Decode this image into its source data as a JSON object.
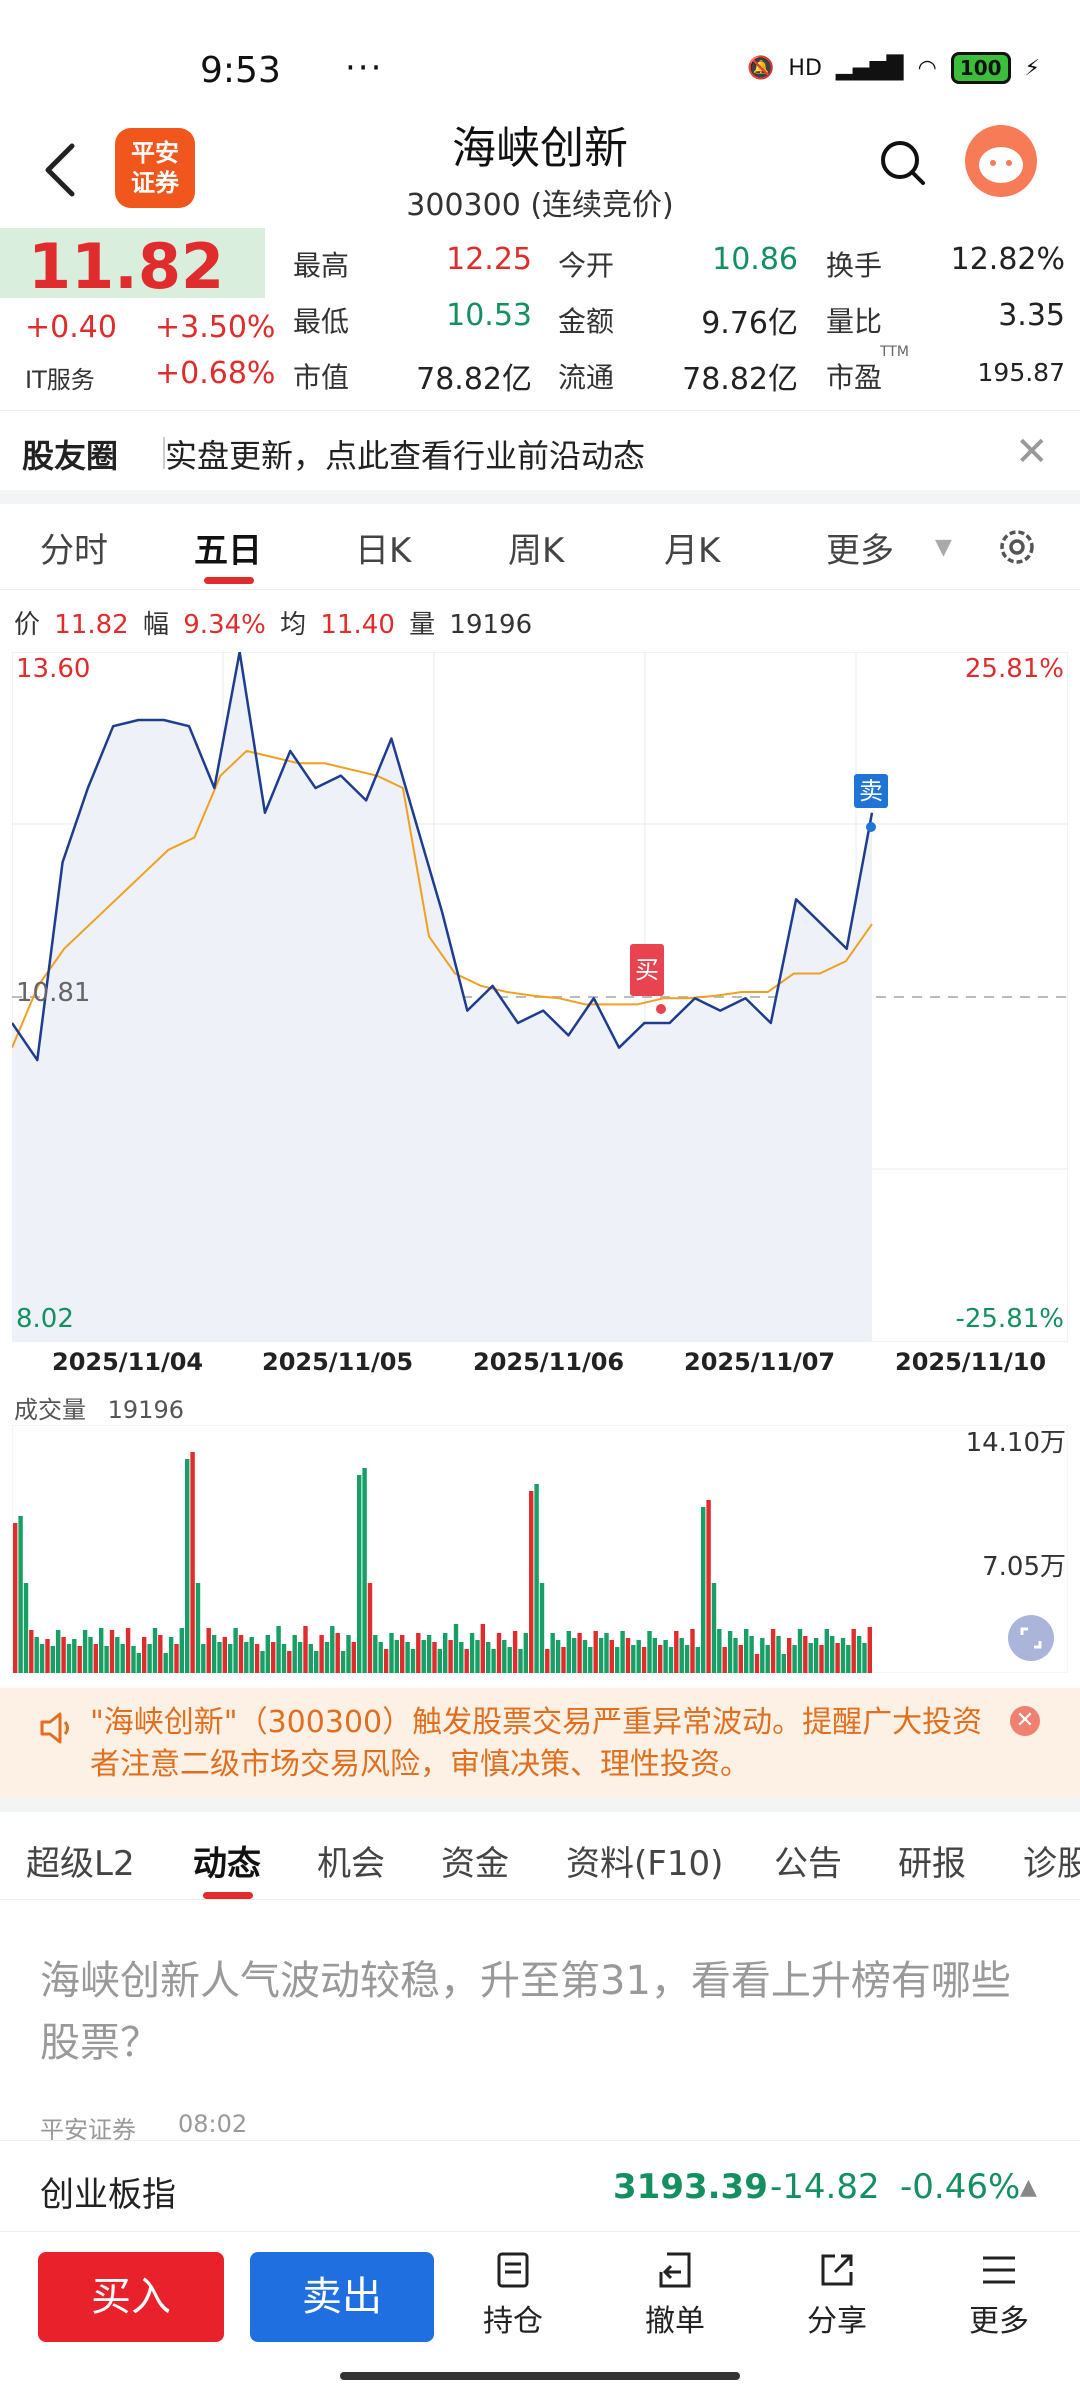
{
  "status_bar": {
    "time": "9:53",
    "dots": "···",
    "network": "HD",
    "battery": "100"
  },
  "header": {
    "stock_name": "海峡创新",
    "stock_code": "300300 (连续竞价)",
    "broker_logo": "平安\n证券"
  },
  "quote": {
    "price": "11.82",
    "change_abs": "+0.40",
    "change_pct": "+3.50%",
    "sector_name": "IT服务",
    "sector_pct": "+0.68%",
    "rows": [
      [
        {
          "label": "最高",
          "value": "12.25",
          "color": "red"
        },
        {
          "label": "今开",
          "value": "10.86",
          "color": "green"
        },
        {
          "label": "换手",
          "value": "12.82%",
          "color": "black"
        }
      ],
      [
        {
          "label": "最低",
          "value": "10.53",
          "color": "green"
        },
        {
          "label": "金额",
          "value": "9.76亿",
          "color": "black"
        },
        {
          "label": "量比",
          "value": "3.35",
          "color": "black"
        }
      ],
      [
        {
          "label": "市值",
          "value": "78.82亿",
          "color": "black"
        },
        {
          "label": "流通",
          "value": "78.82亿",
          "color": "black"
        },
        {
          "label": "市盈",
          "value": "195.87",
          "color": "black",
          "sup": "TTM"
        }
      ]
    ]
  },
  "banner": {
    "title": "股友圈",
    "text": "实盘更新，点此查看行业前沿动态"
  },
  "chart_tabs": {
    "items": [
      "分时",
      "五日",
      "日K",
      "周K",
      "月K",
      "更多"
    ],
    "active": "五日"
  },
  "price_info": {
    "price_label": "价",
    "price": "11.82",
    "amp_label": "幅",
    "amp": "9.34%",
    "avg_label": "均",
    "avg": "11.40",
    "vol_label": "量",
    "vol": "19196"
  },
  "chart_labels": {
    "y_top": "13.60",
    "y_mid": "10.81",
    "y_bottom": "8.02",
    "pct_top": "25.81%",
    "pct_bottom": "-25.81%",
    "buy_marker": "买",
    "sell_marker": "卖"
  },
  "chart_data": {
    "type": "line",
    "x": [
      "2025/11/04",
      "2025/11/05",
      "2025/11/06",
      "2025/11/07",
      "2025/11/10"
    ],
    "ylim": [
      8.02,
      13.6
    ],
    "reference_price": 10.81,
    "series": [
      {
        "points": [
          10.6,
          10.3,
          11.9,
          12.5,
          13.0,
          13.05,
          13.05,
          13.0,
          12.5,
          13.6,
          12.3,
          12.8,
          12.5,
          12.6,
          12.4,
          12.9,
          12.2,
          11.5,
          10.7,
          10.9,
          10.6,
          10.7,
          10.5,
          10.8,
          10.4,
          10.6,
          10.6,
          10.8,
          10.7,
          10.8,
          10.6,
          11.6,
          11.4,
          11.2,
          12.3
        ],
        "stroke": "#1e3d8f"
      },
      {
        "points": [
          10.4,
          10.9,
          11.2,
          11.4,
          11.6,
          11.8,
          12.0,
          12.1,
          12.6,
          12.8,
          12.75,
          12.7,
          12.7,
          12.65,
          12.6,
          12.5,
          11.3,
          11.0,
          10.9,
          10.85,
          10.82,
          10.8,
          10.75,
          10.75,
          10.75,
          10.8,
          10.8,
          10.82,
          10.85,
          10.85,
          11.0,
          11.0,
          11.1,
          11.4
        ],
        "stroke": "#f0a020"
      }
    ],
    "volume": {
      "label": "成交量",
      "value": "19196",
      "max_label": "14.10万",
      "mid_label": "7.05万"
    }
  },
  "warning": {
    "text": "\"海峡创新\"（300300）触发股票交易严重异常波动。提醒广大投资者注意二级市场交易风险，审慎决策、理性投资。"
  },
  "info_tabs": {
    "items": [
      "超级L2",
      "动态",
      "机会",
      "资金",
      "资料(F10)",
      "公告",
      "研报",
      "诊股"
    ],
    "active": "动态"
  },
  "news": {
    "title": "海峡创新人气波动较稳，升至第31，看看上升榜有哪些股票？",
    "source": "平安证券",
    "time": "08:02"
  },
  "index_bar": {
    "name": "创业板指",
    "value": "3193.39",
    "change": "-14.82",
    "pct": "-0.46%"
  },
  "bottom_bar": {
    "buy": "买入",
    "sell": "卖出",
    "tools": [
      "持仓",
      "撤单",
      "分享",
      "更多"
    ]
  },
  "colors": {
    "up": "#e02c2c",
    "down": "#149060",
    "accent": "#1f74d6",
    "price_line": "#1e3d8f",
    "avg_line": "#f0a020"
  }
}
